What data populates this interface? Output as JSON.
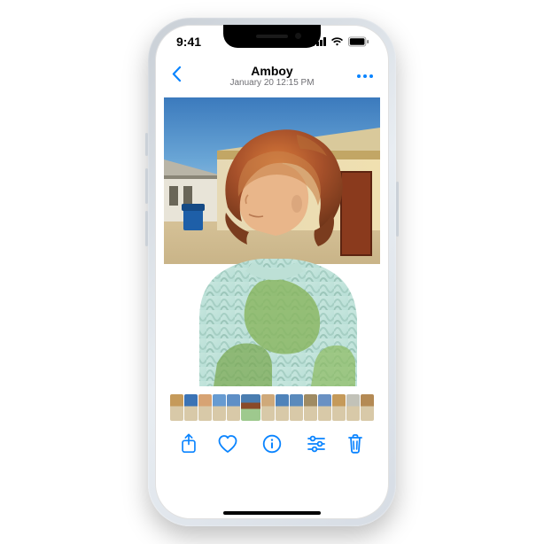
{
  "status": {
    "time": "9:41"
  },
  "nav": {
    "title": "Amboy",
    "subtitle": "January 20  12:15 PM"
  },
  "filmstrip": {
    "thumbs": [
      {
        "c": "#c59a5a"
      },
      {
        "c": "#3b73b5"
      },
      {
        "c": "#d7a373"
      },
      {
        "c": "#679bd1"
      },
      {
        "c": "#5e8fc6"
      },
      {
        "c": "#4a7db0",
        "hair": "#8a4a28",
        "sweater": "#9ec98e",
        "current": true
      },
      {
        "c": "#cfa97a"
      },
      {
        "c": "#4f83ba"
      },
      {
        "c": "#5a8abc"
      },
      {
        "c": "#9f8b63"
      },
      {
        "c": "#6a91c3"
      },
      {
        "c": "#c59a5a"
      },
      {
        "c": "#c2c2b8"
      },
      {
        "c": "#b48a54"
      }
    ]
  },
  "colors": {
    "accent": "#0a84ff"
  }
}
